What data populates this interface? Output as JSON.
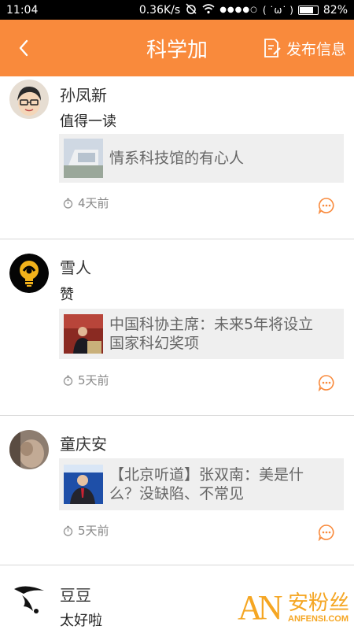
{
  "status_bar": {
    "time": "11:04",
    "network_speed": "0.36K/s",
    "signal_dots": "●●●●○",
    "emoticon": "( ˙ω˙ )",
    "battery_percent": "82%",
    "battery_level": 0.82
  },
  "header": {
    "title": "科学加",
    "publish_label": "发布信息",
    "brand_color": "#f98a3c"
  },
  "posts": [
    {
      "username": "孙凤新",
      "content": "值得一读",
      "link_lines": [
        "情系科技馆的有心人"
      ],
      "time_ago": "4天前"
    },
    {
      "username": "雪人",
      "content": "赞",
      "link_lines": [
        "中国科协主席：未来5年将设立",
        "国家科幻奖项"
      ],
      "time_ago": "5天前"
    },
    {
      "username": "童庆安",
      "link_lines": [
        "【北京听道】张双南：美是什",
        "么？没缺陷、不常见"
      ],
      "time_ago": "5天前"
    },
    {
      "username": "豆豆",
      "content": "太好啦"
    }
  ],
  "watermark": {
    "logo_letters": "AN",
    "cn_text": "安粉丝",
    "en_text": "ANFENSI.COM"
  }
}
